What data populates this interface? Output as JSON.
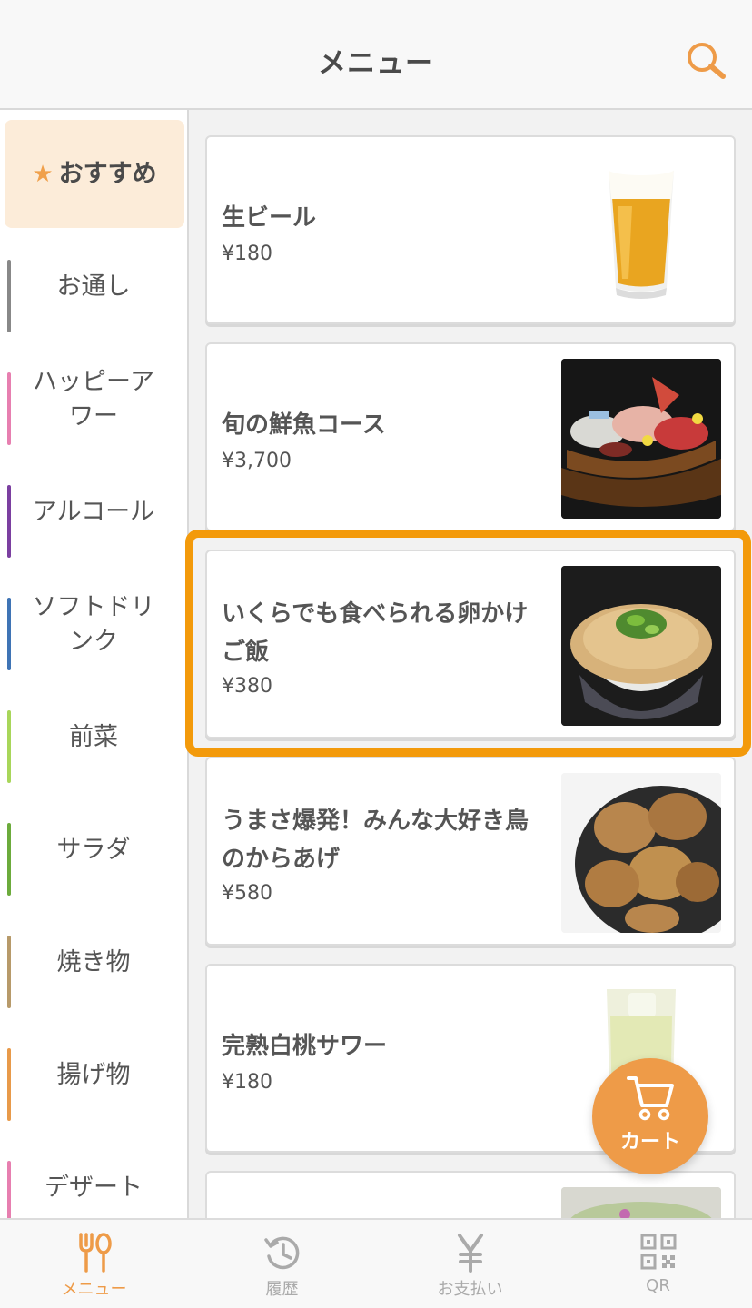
{
  "header": {
    "title": "メニュー",
    "search_icon": "search-icon"
  },
  "sidebar": {
    "active": {
      "icon": "★",
      "label": "おすすめ"
    },
    "items": [
      {
        "label": "お通し",
        "color": "#888888"
      },
      {
        "label": "ハッピーア\nワー",
        "color": "#e77fb0"
      },
      {
        "label": "アルコール",
        "color": "#7b3fa0"
      },
      {
        "label": "ソフトドリ\nンク",
        "color": "#3f74b5"
      },
      {
        "label": "前菜",
        "color": "#a8d65a"
      },
      {
        "label": "サラダ",
        "color": "#6cab3c"
      },
      {
        "label": "焼き物",
        "color": "#b79a6a"
      },
      {
        "label": "揚げ物",
        "color": "#e89a4a"
      },
      {
        "label": "デザート",
        "color": "#e77fb0"
      }
    ]
  },
  "menu": {
    "items": [
      {
        "name": "生ビール",
        "price": "¥180",
        "image": "beer"
      },
      {
        "name": "旬の鮮魚コース",
        "price": "¥3,700",
        "image": "sashimi"
      },
      {
        "name": "いくらでも食べられる卵かけご飯",
        "price": "¥380",
        "image": "rice-bowl"
      },
      {
        "name": "うまさ爆発！みんな大好き鳥のからあげ",
        "price": "¥580",
        "image": "karaage"
      },
      {
        "name": "完熟白桃サワー",
        "price": "¥180",
        "image": "sour"
      }
    ]
  },
  "cart": {
    "label": "カート"
  },
  "bottom_nav": {
    "items": [
      {
        "label": "メニュー",
        "icon": "fork-spoon-icon",
        "active": true
      },
      {
        "label": "履歴",
        "icon": "history-icon",
        "active": false
      },
      {
        "label": "お支払い",
        "icon": "yen-icon",
        "active": false
      },
      {
        "label": "QR",
        "icon": "qr-icon",
        "active": false
      }
    ]
  },
  "colors": {
    "accent": "#ee9b48",
    "highlight": "#f39a0b"
  }
}
